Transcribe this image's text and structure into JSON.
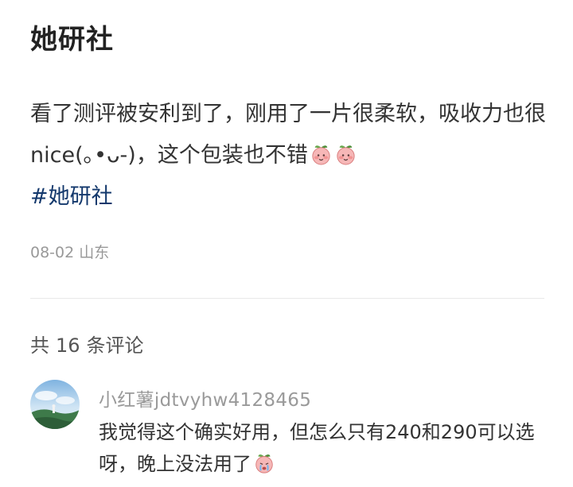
{
  "note": {
    "title": "她研社",
    "body": "看了测评被安利到了，刚用了一片很柔软，吸收力也很nice(｡•ᴗ-)，这个包装也不错",
    "body_emojis": [
      "peach-cute-emoji",
      "peach-cute-emoji"
    ],
    "hashtag": "#她研社",
    "date": "08-02",
    "location": "山东"
  },
  "comments_section": {
    "prefix": "共",
    "count": "16",
    "suffix": "条评论"
  },
  "comments": [
    {
      "username": "小红薯jdtvyhw4128465",
      "text": "我觉得这个确实好用，但怎么只有240和290可以选呀，晚上没法用了",
      "emoji": "peach-crying-emoji",
      "avatar": "landscape-avatar"
    }
  ],
  "colors": {
    "hashtag": "#13386c",
    "meta_text": "#999999",
    "username": "#9a9a9a",
    "divider": "#e8e8e8"
  }
}
